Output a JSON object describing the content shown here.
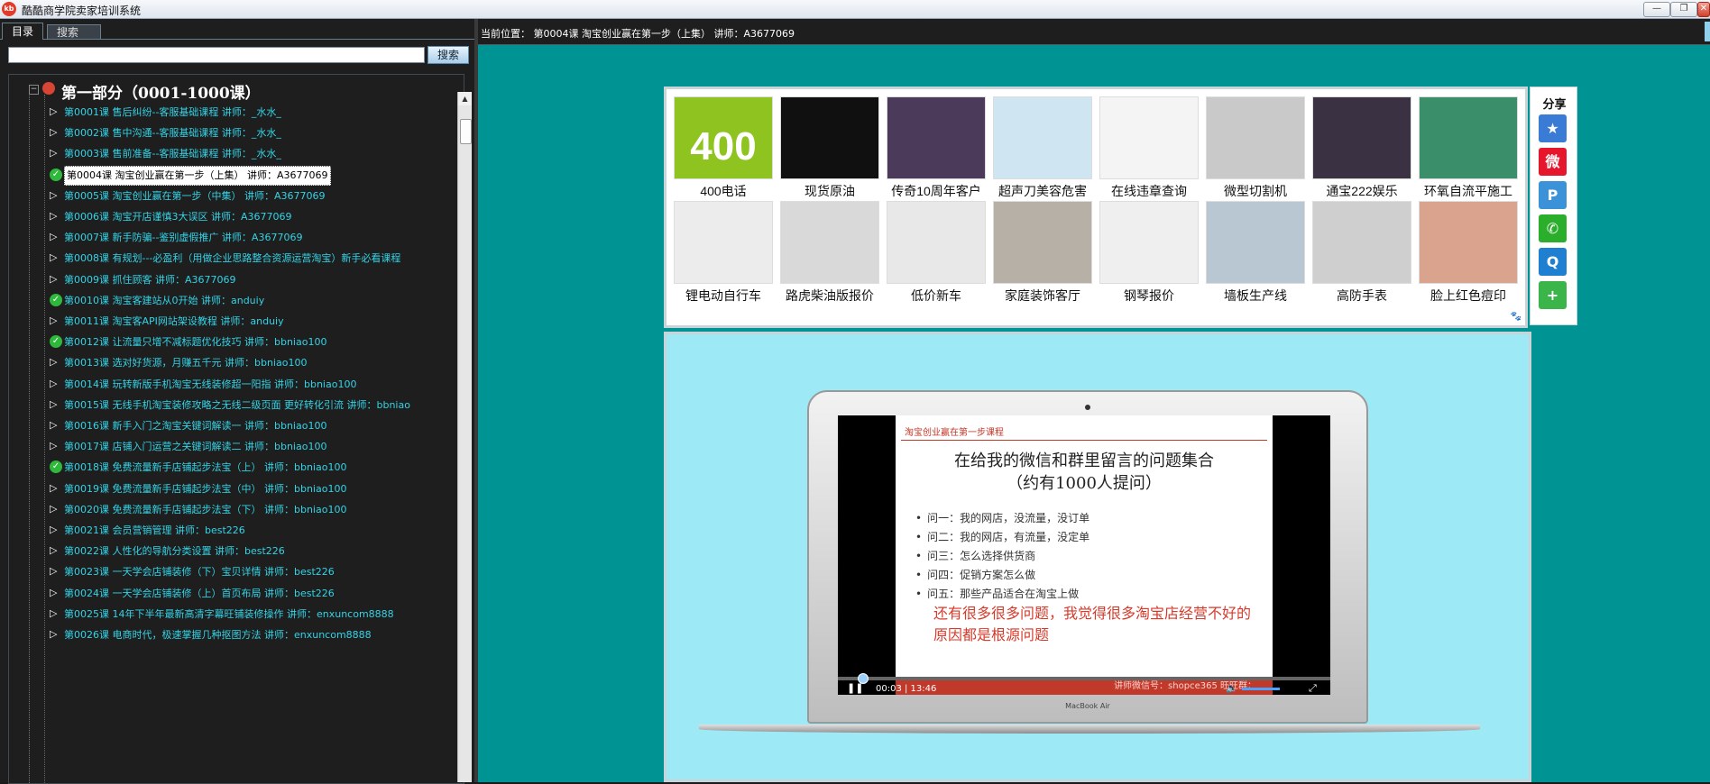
{
  "window": {
    "title": "酷酷商学院卖家培训系统",
    "icon_text": "kb",
    "controls": [
      "—",
      "❐",
      "✕"
    ]
  },
  "left": {
    "tabs": [
      {
        "label": "目录"
      },
      {
        "label": "搜索"
      }
    ],
    "search": {
      "value": "",
      "button_label": "搜索"
    },
    "tree": {
      "root_label": "第一部分（0001-1000课）",
      "lessons": [
        {
          "label": "第0001课 售后纠纷--客服基础课程   讲师：_水水_",
          "status": "play"
        },
        {
          "label": "第0002课 售中沟通--客服基础课程   讲师：_水水_",
          "status": "play"
        },
        {
          "label": "第0003课 售前准备--客服基础课程   讲师：_水水_",
          "status": "play"
        },
        {
          "label": "第0004课 淘宝创业赢在第一步（上集）  讲师：A3677069",
          "status": "done",
          "selected": true
        },
        {
          "label": "第0005课 淘宝创业赢在第一步（中集）  讲师：A3677069",
          "status": "play"
        },
        {
          "label": "第0006课 淘宝开店谨慎3大误区   讲师：A3677069",
          "status": "play"
        },
        {
          "label": "第0007课 新手防骗--鉴别虚假推广   讲师：A3677069",
          "status": "play"
        },
        {
          "label": "第0008课 有规划---必盈利（用做企业思路整合资源运营淘宝）新手必看课程",
          "status": "play"
        },
        {
          "label": "第0009课 抓住顾客   讲师：A3677069",
          "status": "play"
        },
        {
          "label": "第0010课 淘宝客建站从0开始   讲师：anduiy",
          "status": "done"
        },
        {
          "label": "第0011课 淘宝客API网站架设教程   讲师：anduiy",
          "status": "play"
        },
        {
          "label": "第0012课 让流量只增不减标题优化技巧   讲师：bbniao100",
          "status": "done"
        },
        {
          "label": "第0013课 选对好货源，月赚五千元   讲师：bbniao100",
          "status": "play"
        },
        {
          "label": "第0014课 玩转新版手机淘宝无线装修超一阳指   讲师：bbniao100",
          "status": "play"
        },
        {
          "label": "第0015课 无线手机淘宝装修攻略之无线二级页面 更好转化引流   讲师：bbniao",
          "status": "play"
        },
        {
          "label": "第0016课 新手入门之淘宝关键词解读一   讲师：bbniao100",
          "status": "play"
        },
        {
          "label": "第0017课 店铺入门运营之关键词解读二   讲师：bbniao100",
          "status": "play"
        },
        {
          "label": "第0018课 免费流量新手店铺起步法宝（上）   讲师：bbniao100",
          "status": "done"
        },
        {
          "label": "第0019课 免费流量新手店铺起步法宝（中）   讲师：bbniao100",
          "status": "play"
        },
        {
          "label": "第0020课 免费流量新手店铺起步法宝（下）   讲师：bbniao100",
          "status": "play"
        },
        {
          "label": "第0021课 会员营销管理   讲师：best226",
          "status": "play"
        },
        {
          "label": "第0022课 人性化的导航分类设置    讲师：best226",
          "status": "play"
        },
        {
          "label": "第0023课 一天学会店铺装修（下）宝贝详情   讲师：best226",
          "status": "play"
        },
        {
          "label": "第0024课 一天学会店铺装修（上）首页布局   讲师：best226",
          "status": "play"
        },
        {
          "label": "第0025课 14年下半年最新高清字幕旺铺装修操作   讲师：enxuncom8888",
          "status": "play"
        },
        {
          "label": "第0026课 电商时代，极速掌握几种抠图方法   讲师：enxuncom8888",
          "status": "play"
        }
      ]
    }
  },
  "right": {
    "path": "当前位置： 第0004课 淘宝创业赢在第一步（上集）   讲师：A3677069",
    "ads": [
      {
        "label": "400电话",
        "thumb_text": "400",
        "color": "#8fc31f"
      },
      {
        "label": "现货原油",
        "color": "#101010"
      },
      {
        "label": "传奇10周年客户",
        "color": "#4b3a5a"
      },
      {
        "label": "超声刀美容危害",
        "color": "#cfe6f2"
      },
      {
        "label": "在线违章查询",
        "color": "#f4f4f4"
      },
      {
        "label": "微型切割机",
        "color": "#c9c9c9"
      },
      {
        "label": "通宝222娱乐",
        "color": "#3a3142"
      },
      {
        "label": "环氧自流平施工",
        "color": "#3a8f6a"
      },
      {
        "label": "锂电动自行车",
        "color": "#ececec"
      },
      {
        "label": "路虎柴油版报价",
        "color": "#d9d9d9"
      },
      {
        "label": "低价新车",
        "color": "#e8e8e8"
      },
      {
        "label": "家庭装饰客厅",
        "color": "#b7b0a6"
      },
      {
        "label": "钢琴报价",
        "color": "#efefef"
      },
      {
        "label": "墙板生产线",
        "color": "#b9c7d2"
      },
      {
        "label": "高防手表",
        "color": "#cfcfcf"
      },
      {
        "label": "脸上红色痘印",
        "color": "#d9a38d"
      }
    ],
    "share": {
      "title": "分享",
      "buttons": [
        {
          "name": "star-share-icon",
          "glyph": "★",
          "color": "#3a7bd5"
        },
        {
          "name": "weibo-icon",
          "glyph": "微",
          "color": "#e6162d"
        },
        {
          "name": "pinterest-like-icon",
          "glyph": "P",
          "color": "#3b92d8"
        },
        {
          "name": "wechat-icon",
          "glyph": "✆",
          "color": "#2bae2b"
        },
        {
          "name": "qq-icon",
          "glyph": "Q",
          "color": "#1f7fd1"
        },
        {
          "name": "more-share-icon",
          "glyph": "+",
          "color": "#3bb54a"
        }
      ]
    },
    "video": {
      "slide_course": "淘宝创业赢在第一步课程",
      "slide_heading_1": "在给我的微信和群里留言的问题集合",
      "slide_heading_2": "（约有1000人提问）",
      "bullets": [
        "问一：我的网店，没流量，没订单",
        "问二：我的网店，有流量，没定单",
        "问三：怎么选择供货商",
        "问四：促销方案怎么做",
        "问五：那些产品适合在淘宝上做"
      ],
      "note": "还有很多很多问题，我觉得很多淘宝店经营不好的原因都是根源问题",
      "footer": "讲师微信号：shopce365    旺旺群：",
      "time": "00:03 | 13:46",
      "progress": 0.04,
      "brand": "MacBook Air"
    }
  }
}
